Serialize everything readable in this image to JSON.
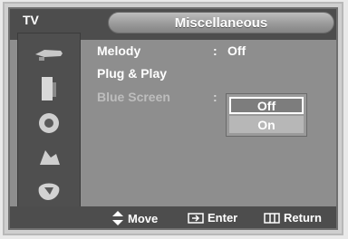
{
  "header": {
    "source_tab": "TV",
    "title": "Miscellaneous"
  },
  "side_icons": [
    "picture-icon",
    "sound-icon",
    "channel-icon",
    "setup-icon",
    "input-icon"
  ],
  "menu": {
    "items": [
      {
        "label": "Melody",
        "value": "Off"
      },
      {
        "label": "Plug & Play"
      },
      {
        "label": "Blue Screen"
      }
    ],
    "separator": ":"
  },
  "dropdown": {
    "options": [
      "Off",
      "On"
    ],
    "selected": "Off"
  },
  "footer": {
    "move": "Move",
    "enter": "Enter",
    "return": "Return"
  }
}
